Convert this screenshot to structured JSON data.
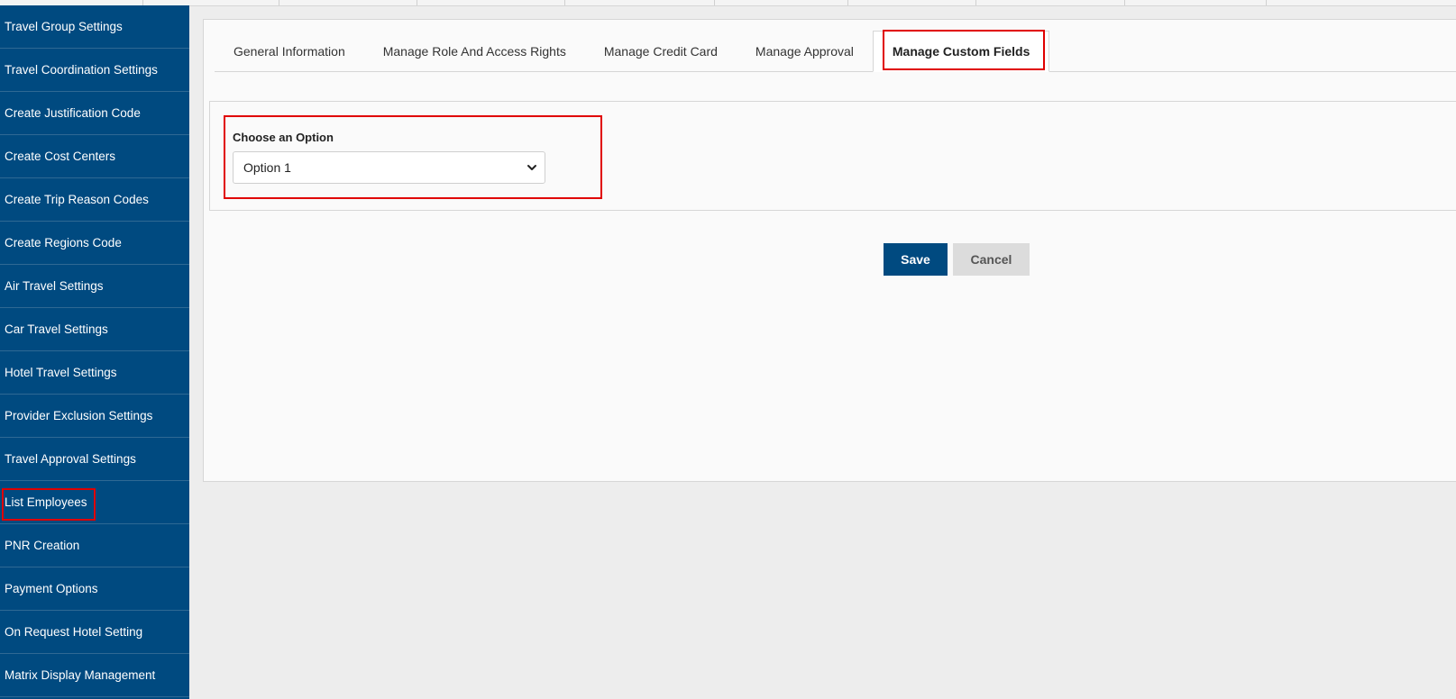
{
  "sidebar": {
    "items": [
      {
        "label": "Travel Group Settings"
      },
      {
        "label": "Travel Coordination Settings"
      },
      {
        "label": "Create Justification Code"
      },
      {
        "label": "Create Cost Centers"
      },
      {
        "label": "Create Trip Reason Codes"
      },
      {
        "label": "Create Regions Code"
      },
      {
        "label": "Air Travel Settings"
      },
      {
        "label": "Car Travel Settings"
      },
      {
        "label": "Hotel Travel Settings"
      },
      {
        "label": "Provider Exclusion Settings"
      },
      {
        "label": "Travel Approval Settings"
      },
      {
        "label": "List Employees"
      },
      {
        "label": "PNR Creation"
      },
      {
        "label": "Payment Options"
      },
      {
        "label": "On Request Hotel Setting"
      },
      {
        "label": "Matrix Display Management"
      }
    ]
  },
  "tabs": [
    {
      "label": "General Information"
    },
    {
      "label": "Manage Role And Access Rights"
    },
    {
      "label": "Manage Credit Card"
    },
    {
      "label": "Manage Approval"
    },
    {
      "label": "Manage Custom Fields"
    }
  ],
  "custom_fields": {
    "option_label": "Choose an Option",
    "selected_option": "Option 1"
  },
  "actions": {
    "save_label": "Save",
    "cancel_label": "Cancel"
  },
  "colors": {
    "sidebar_bg": "#004a80",
    "primary_button": "#004a80",
    "highlight": "#e00000",
    "page_bg": "#ededed"
  }
}
